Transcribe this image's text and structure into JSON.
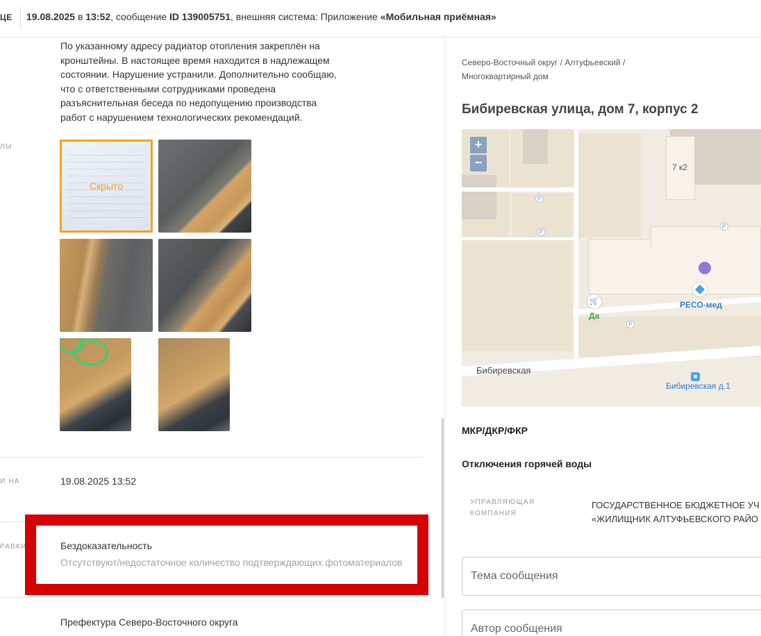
{
  "topbar": {
    "cut_label": "ЦЕ",
    "date": "19.08.2025",
    "in_word": " в ",
    "time": "13:52",
    "message_prefix": ", сообщение ",
    "message_id": "ID 139005751",
    "system_prefix": ", внешняя система: Приложение ",
    "system_name": "«Мобильная приёмная»"
  },
  "response": {
    "text": "По указанному адресу радиатор отопления закреплён на кронштейны. В настоящее время находится в надлежащем состоянии. Нарушение устранили. Дополнительно сообщаю, что с ответственными сотрудниками проведена разъяснительная беседа по недопущению производства работ с нарушением технологических рекомендаций."
  },
  "side_labels": {
    "files": "лы",
    "date_field": "и на",
    "decision": "равки..."
  },
  "photos": {
    "hidden_label": "Скрыто"
  },
  "date_value": "19.08.2025 13:52",
  "decision": {
    "title": "Бездоказательность",
    "subtitle": "Отсутствуют/недостаточное количество подтверждающих фотоматериалов"
  },
  "prefecture": "Префектура Северо-Восточного округа",
  "right": {
    "breadcrumb": "Северо-Восточный округ / Алтуфьевский / Многоквартирный дом",
    "address": "Бибиревская улица, дом 7, корпус 2",
    "map": {
      "zoom_in": "+",
      "zoom_out": "−",
      "building_label": "7 к2",
      "poi_reso": "РЕСО-мед",
      "poi_da": "Да",
      "street": "Бибиревская",
      "bus_stop": "Бибиревская д.1",
      "parking": "P"
    },
    "mkr": "МКР/ДКР/ФКР",
    "hot_water": "Отключения горячей воды",
    "uk_label": "Управляющая компания",
    "uk_line1": "ГОСУДАРСТВЕННОЕ БЮДЖЕТНОЕ УЧ",
    "uk_line2": "«ЖИЛИЩНИК АЛТУФЬЕВСКОГО РАЙО",
    "topic_placeholder": "Тема сообщения",
    "author_placeholder": "Автор сообщения"
  },
  "colors": {
    "accent_orange": "#f5a31a",
    "highlight_red": "#d60000",
    "map_pin": "#8e7ad6"
  }
}
